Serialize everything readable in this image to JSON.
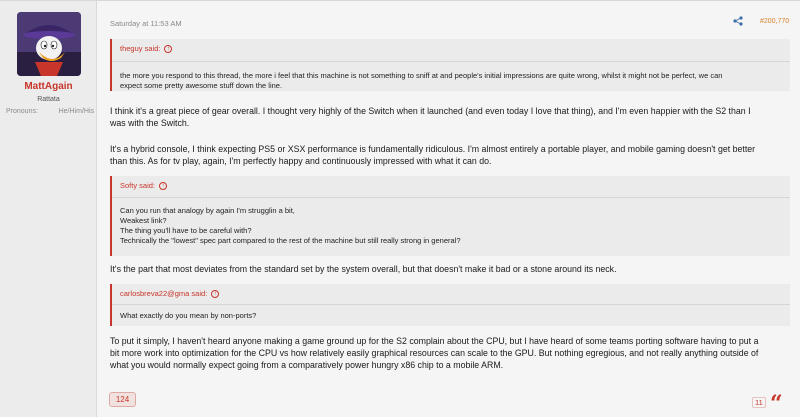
{
  "user": {
    "name": "MattAgain",
    "title": "Rattata",
    "pronouns_label": "Pronouns:",
    "pronouns_value": "He/Him/His"
  },
  "post": {
    "date": "Saturday at 11:53 AM",
    "number": "#200,770",
    "quotes": [
      {
        "author": "theguy said:",
        "lines": [
          "the more you respond to this thread, the more i feel that this machine is not something to sniff at and people's initial impressions are quite wrong, whilst it might not be perfect, we can",
          "expect some pretty awesome stuff down the line."
        ]
      },
      {
        "author": "Softy said:",
        "lines": [
          "Can you run that analogy by again I'm strugglin a bit,",
          "Weakest link?",
          "The thing you'll have to be careful with?",
          "Technically the \"lowest\" spec part compared to the rest of the machine but still really strong in general?"
        ]
      },
      {
        "author": "carlosbreva22@gma said:",
        "lines": [
          "What exactly do you mean by non-ports?"
        ]
      }
    ],
    "paragraphs": [
      [
        "I think it's a great piece of gear overall. I thought very highly of the Switch when it launched (and even today I love that thing), and I'm even happier with the S2 than I",
        "was with the Switch."
      ],
      [
        "It's a hybrid console, I think expecting PS5 or XSX performance is fundamentally ridiculous. I'm almost entirely a portable player, and mobile gaming doesn't get better",
        "than this. As for tv play, again, I'm perfectly happy and continuously impressed with what it can do."
      ],
      [
        "It's the part that most deviates from the standard set by the system overall, but that doesn't make it bad or a stone around its neck."
      ],
      [
        "To put it simply, I haven't heard anyone making a game ground up for the S2 complain about the CPU, but I have heard of some teams porting software having to put a",
        "bit more work into optimization for the CPU vs how relatively easily graphical resources can scale to the GPU. But nothing egregious, and not really anything outside of",
        "what you would normally expect going from a comparatively power hungry x86 chip to a mobile ARM."
      ]
    ],
    "reaction_count": "124",
    "like_count": "11",
    "quote_glyph": "“"
  },
  "colors": {
    "accent": "#c8352a",
    "post_number": "#d9822b"
  },
  "icons": {
    "share": "share-icon",
    "quote_up": "arrow-up-circle-icon",
    "quote": "quote-icon"
  }
}
